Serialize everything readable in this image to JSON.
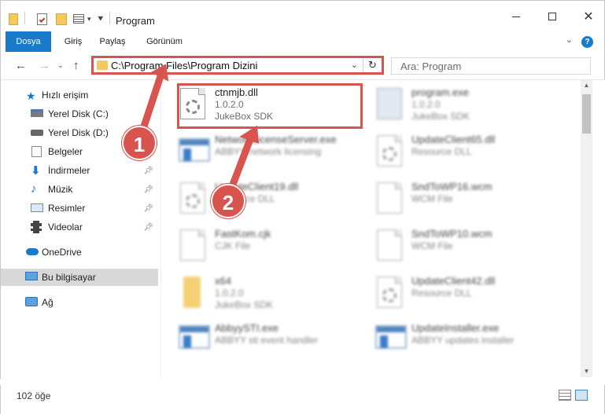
{
  "window": {
    "title": "Program"
  },
  "ribbon": {
    "tabs": [
      "Dosya",
      "Giriş",
      "Paylaş",
      "Görünüm"
    ],
    "help": "?"
  },
  "address": {
    "path": "C:\\Program Files\\Program Dizini"
  },
  "search": {
    "placeholder": "Ara: Program"
  },
  "sidebar": {
    "quick_access": "Hızlı erişim",
    "items": [
      "Yerel Disk (C:)",
      "Yerel Disk (D:)",
      "Belgeler",
      "İndirmeler",
      "Müzik",
      "Resimler",
      "Videolar"
    ],
    "onedrive": "OneDrive",
    "this_pc": "Bu bilgisayar",
    "network": "Ağ"
  },
  "files": [
    {
      "name": "ctnmjb.dll",
      "line2": "1.0.2.0",
      "line3": "JukeBox SDK",
      "icon": "dll-gear-icon"
    },
    {
      "name": "program.exe",
      "line2": "1.0.2.0",
      "line3": "JukeBox SDK",
      "icon": "exe-icon"
    },
    {
      "name": "NetworkLicenseServer.exe",
      "line2": "ABBYY network licensing",
      "line3": "",
      "icon": "app-window-icon"
    },
    {
      "name": "UpdateClient65.dll",
      "line2": "Resource DLL",
      "line3": "",
      "icon": "dll-gear-icon"
    },
    {
      "name": "UpdateClient19.dll",
      "line2": "Resource DLL",
      "line3": "",
      "icon": "dll-gear-icon"
    },
    {
      "name": "SndToWP16.wcm",
      "line2": "WCM File",
      "line3": "",
      "icon": "document-icon"
    },
    {
      "name": "FastKom.cjk",
      "line2": "CJK File",
      "line3": "",
      "icon": "document-icon"
    },
    {
      "name": "SndToWP10.wcm",
      "line2": "WCM File",
      "line3": "",
      "icon": "document-icon"
    },
    {
      "name": "x64",
      "line2": "1.0.2.0",
      "line3": "JukeBox SDK",
      "icon": "folder-icon"
    },
    {
      "name": "UpdateClient42.dll",
      "line2": "Resource DLL",
      "line3": "",
      "icon": "dll-gear-icon"
    },
    {
      "name": "AbbyySTI.exe",
      "line2": "ABBYY sti event handler",
      "line3": "",
      "icon": "app-window-icon"
    },
    {
      "name": "UpdateInstaller.exe",
      "line2": "ABBYY updates installer",
      "line3": "",
      "icon": "app-window-icon"
    }
  ],
  "status": {
    "count": "102 öğe"
  },
  "callouts": [
    "1",
    "2"
  ],
  "colors": {
    "accent": "#1979ca",
    "highlight": "#d9534f",
    "folder": "#f4c95d"
  }
}
